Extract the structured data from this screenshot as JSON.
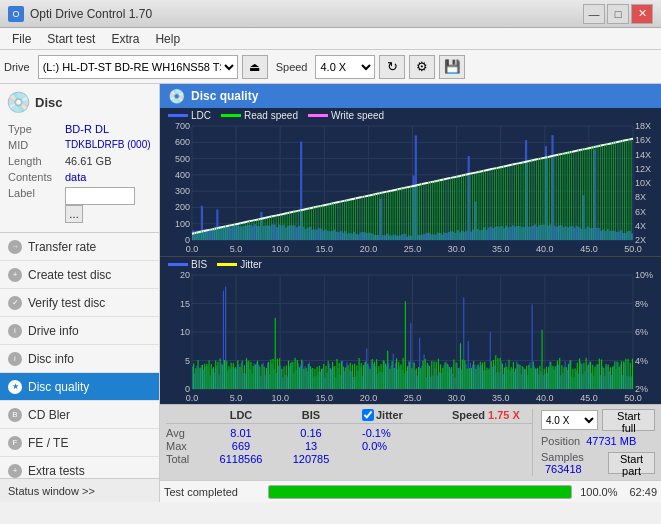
{
  "titleBar": {
    "title": "Opti Drive Control 1.70",
    "minBtn": "—",
    "maxBtn": "□",
    "closeBtn": "✕"
  },
  "menuBar": {
    "items": [
      "File",
      "Start test",
      "Extra",
      "Help"
    ]
  },
  "toolbar": {
    "driveLabel": "Drive",
    "driveValue": "(L:) HL-DT-ST BD-RE WH16NS58 TST4",
    "speedLabel": "Speed",
    "speedValue": "4.0 X"
  },
  "disc": {
    "typeLabel": "Type",
    "typeValue": "BD-R DL",
    "midLabel": "MID",
    "midValue": "TDKBLDRFB (000)",
    "lengthLabel": "Length",
    "lengthValue": "46.61 GB",
    "contentsLabel": "Contents",
    "contentsValue": "data",
    "labelLabel": "Label"
  },
  "nav": {
    "items": [
      {
        "id": "transfer-rate",
        "label": "Transfer rate",
        "active": false
      },
      {
        "id": "create-test-disc",
        "label": "Create test disc",
        "active": false
      },
      {
        "id": "verify-test-disc",
        "label": "Verify test disc",
        "active": false
      },
      {
        "id": "drive-info",
        "label": "Drive info",
        "active": false
      },
      {
        "id": "disc-info",
        "label": "Disc info",
        "active": false
      },
      {
        "id": "disc-quality",
        "label": "Disc quality",
        "active": true
      },
      {
        "id": "cd-bler",
        "label": "CD Bler",
        "active": false
      },
      {
        "id": "fe-te",
        "label": "FE / TE",
        "active": false
      },
      {
        "id": "extra-tests",
        "label": "Extra tests",
        "active": false
      }
    ]
  },
  "statusWindow": "Status window >>",
  "contentHeader": "Disc quality",
  "charts": {
    "top": {
      "legend": [
        {
          "label": "LDC",
          "color": "#4444ff"
        },
        {
          "label": "Read speed",
          "color": "#00ee00"
        },
        {
          "label": "Write speed",
          "color": "#ff44ff"
        }
      ],
      "yAxisLeft": [
        "700",
        "600",
        "500",
        "400",
        "300",
        "200",
        "100",
        "0"
      ],
      "yAxisRight": [
        "18X",
        "16X",
        "14X",
        "12X",
        "10X",
        "8X",
        "6X",
        "4X",
        "2X"
      ],
      "xAxis": [
        "0.0",
        "5.0",
        "10.0",
        "15.0",
        "20.0",
        "25.0",
        "30.0",
        "35.0",
        "40.0",
        "45.0",
        "50.0"
      ]
    },
    "bottom": {
      "legend": [
        {
          "label": "BIS",
          "color": "#4444ff"
        },
        {
          "label": "Jitter",
          "color": "#ffff00"
        }
      ],
      "yAxisLeft": [
        "20",
        "15",
        "10",
        "5",
        "0"
      ],
      "yAxisRight": [
        "10%",
        "8%",
        "6%",
        "4%",
        "2%"
      ],
      "xAxis": [
        "0.0",
        "5.0",
        "10.0",
        "15.0",
        "20.0",
        "25.0",
        "30.0",
        "35.0",
        "40.0",
        "45.0",
        "50.0"
      ]
    }
  },
  "stats": {
    "headers": [
      "",
      "LDC",
      "BIS",
      "",
      "Jitter",
      "Speed",
      ""
    ],
    "rows": [
      {
        "label": "Avg",
        "ldc": "8.01",
        "bis": "0.16",
        "jitter": "-0.1%"
      },
      {
        "label": "Max",
        "ldc": "669",
        "bis": "13",
        "jitter": "0.0%"
      },
      {
        "label": "Total",
        "ldc": "6118566",
        "bis": "120785",
        "jitter": ""
      }
    ],
    "jitterChecked": true,
    "speedValue": "1.75 X",
    "speedSelect": "4.0 X",
    "positionLabel": "Position",
    "positionValue": "47731 MB",
    "samplesLabel": "Samples",
    "samplesValue": "763418",
    "startFullBtn": "Start full",
    "startPartBtn": "Start part"
  },
  "statusBar": {
    "text": "Test completed",
    "progress": 100,
    "progressLabel": "100.0%",
    "time": "62:49"
  }
}
